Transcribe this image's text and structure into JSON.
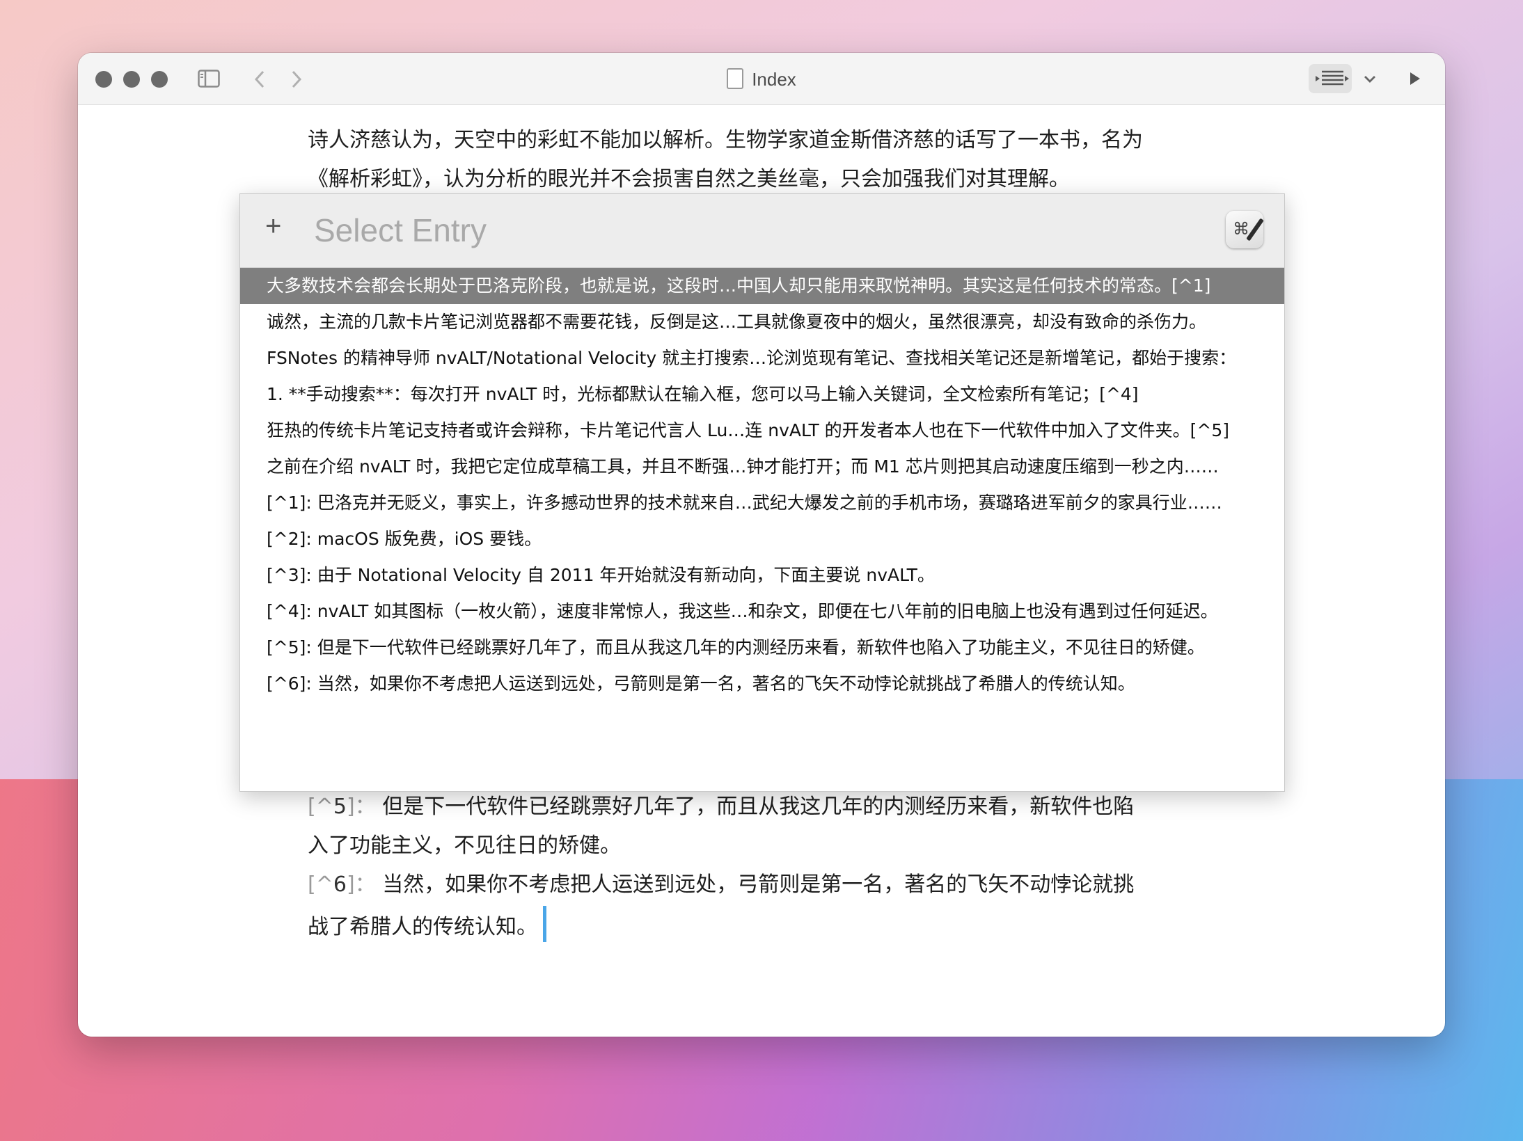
{
  "window": {
    "title": "Index"
  },
  "editor": {
    "top_lines": [
      "诗人济慈认为，天空中的彩虹不能加以解析。生物学家道金斯借济慈的话写了一本书，名为",
      "《解析彩虹》，认为分析的眼光并不会损害自然之美丝毫，只会加强我们对其理解。"
    ],
    "fn5": {
      "open": "[^",
      "num": "5",
      "close": "]：",
      "text": "但是下一代软件已经跳票好几年了，而且从我这几年的内测经历来看，新软件也陷",
      "cont": "入了功能主义，不见往日的矫健。"
    },
    "fn6": {
      "open": "[^",
      "num": "6",
      "close": "]：",
      "text": "当然，如果你不考虑把人运送到远处，弓箭则是第一名，著名的飞矢不动悖论就挑",
      "cont": "战了希腊人的传统认知。"
    }
  },
  "palette": {
    "plus_label": "+",
    "placeholder": "Select Entry",
    "app_icon_glyph": "⌘",
    "selected_index": 0,
    "results": [
      "大多数技术会都会长期处于巴洛克阶段，也就是说，这段时…中国人却只能用来取悦神明。其实这是任何技术的常态。[^1]",
      "诚然，主流的几款卡片笔记浏览器都不需要花钱，反倒是这…工具就像夏夜中的烟火，虽然很漂亮，却没有致命的杀伤力。",
      "FSNotes 的精神导师 nvALT/Notational Velocity 就主打搜索…论浏览现有笔记、查找相关笔记还是新增笔记，都始于搜索：",
      "1. **手动搜索**：每次打开 nvALT 时，光标都默认在输入框，您可以马上输入关键词，全文检索所有笔记；[^4]",
      "狂热的传统卡片笔记支持者或许会辩称，卡片笔记代言人 Lu…连 nvALT 的开发者本人也在下一代软件中加入了文件夹。[^5]",
      "之前在介绍 nvALT 时，我把它定位成草稿工具，并且不断强…钟才能打开；而 M1 芯片则把其启动速度压缩到一秒之内……",
      "[^1]: 巴洛克并无贬义，事实上，许多撼动世界的技术就来自…武纪大爆发之前的手机市场，赛璐珞进军前夕的家具行业……",
      "[^2]: macOS 版免费，iOS 要钱。",
      "[^3]: 由于 Notational Velocity 自 2011 年开始就没有新动向，下面主要说 nvALT。",
      "[^4]: nvALT 如其图标（一枚火箭），速度非常惊人，我这些…和杂文，即便在七八年前的旧电脑上也没有遇到过任何延迟。",
      "[^5]: 但是下一代软件已经跳票好几年了，而且从我这几年的内测经历来看，新软件也陷入了功能主义，不见往日的矫健。",
      "[^6]: 当然，如果你不考虑把人运送到远处，弓箭则是第一名，著名的飞矢不动悖论就挑战了希腊人的传统认知。"
    ]
  }
}
